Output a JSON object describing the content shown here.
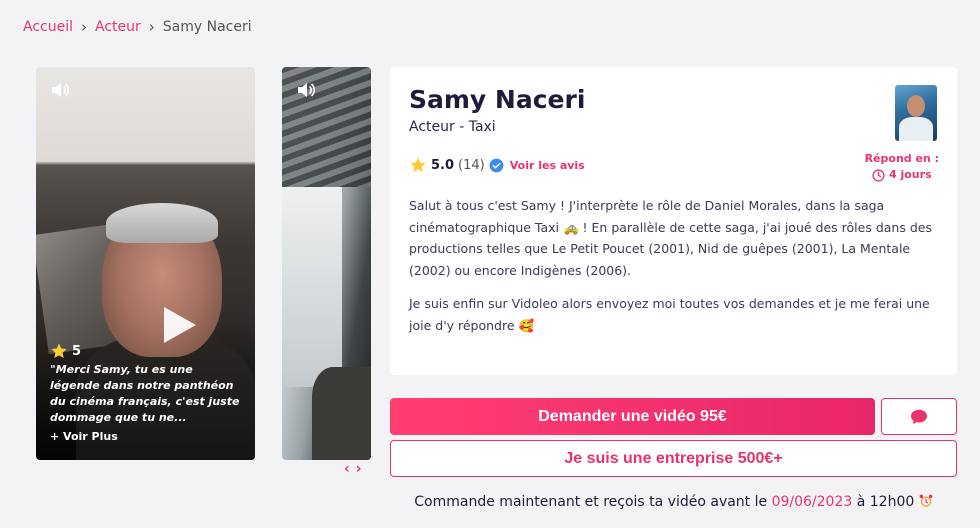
{
  "breadcrumb": {
    "items": [
      "Accueil",
      "Acteur"
    ],
    "current": "Samy Naceri"
  },
  "videos": [
    {
      "rating": "5",
      "quote": "\"Merci Samy, tu es une légende dans notre panthéon du cinéma français, c'est juste dommage que tu ne...",
      "more": "+ Voir Plus"
    }
  ],
  "carousel": {
    "prev": "‹",
    "next": "›"
  },
  "profile": {
    "name": "Samy Naceri",
    "subtitle": "Acteur - Taxi",
    "score": "5.0",
    "review_count": "(14)",
    "reviews_link": "Voir les avis",
    "responds_label": "Répond en :",
    "responds_value": "4 jours",
    "bio": [
      "Salut à tous c'est Samy ! J'interprète le rôle de Daniel Morales, dans la saga cinématographique Taxi 🚕 ! En parallèle de cette saga, j'ai joué des rôles dans des productions telles que Le Petit Poucet (2001), Nid de guêpes (2001), La Mentale (2002) ou encore Indigènes (2006).",
      "Je suis enfin sur Vidoleo alors envoyez moi toutes vos demandes et je me ferai une joie d'y répondre 🥰"
    ]
  },
  "actions": {
    "request_label": "Demander une vidéo 95€",
    "enterprise_label": "Je suis une entreprise 500€+"
  },
  "delivery": {
    "prefix": "Commande maintenant et reçois ta vidéo avant le",
    "date": "09/06/2023",
    "suffix": "à 12h00"
  },
  "colors": {
    "accent": "#e8336d",
    "text": "#1d1d3b",
    "background": "#f3f3f6"
  },
  "icons": [
    "chevron-right-icon",
    "speaker-icon",
    "play-icon",
    "star-icon",
    "verified-icon",
    "clock-icon",
    "chat-icon",
    "alarm-clock-icon"
  ]
}
